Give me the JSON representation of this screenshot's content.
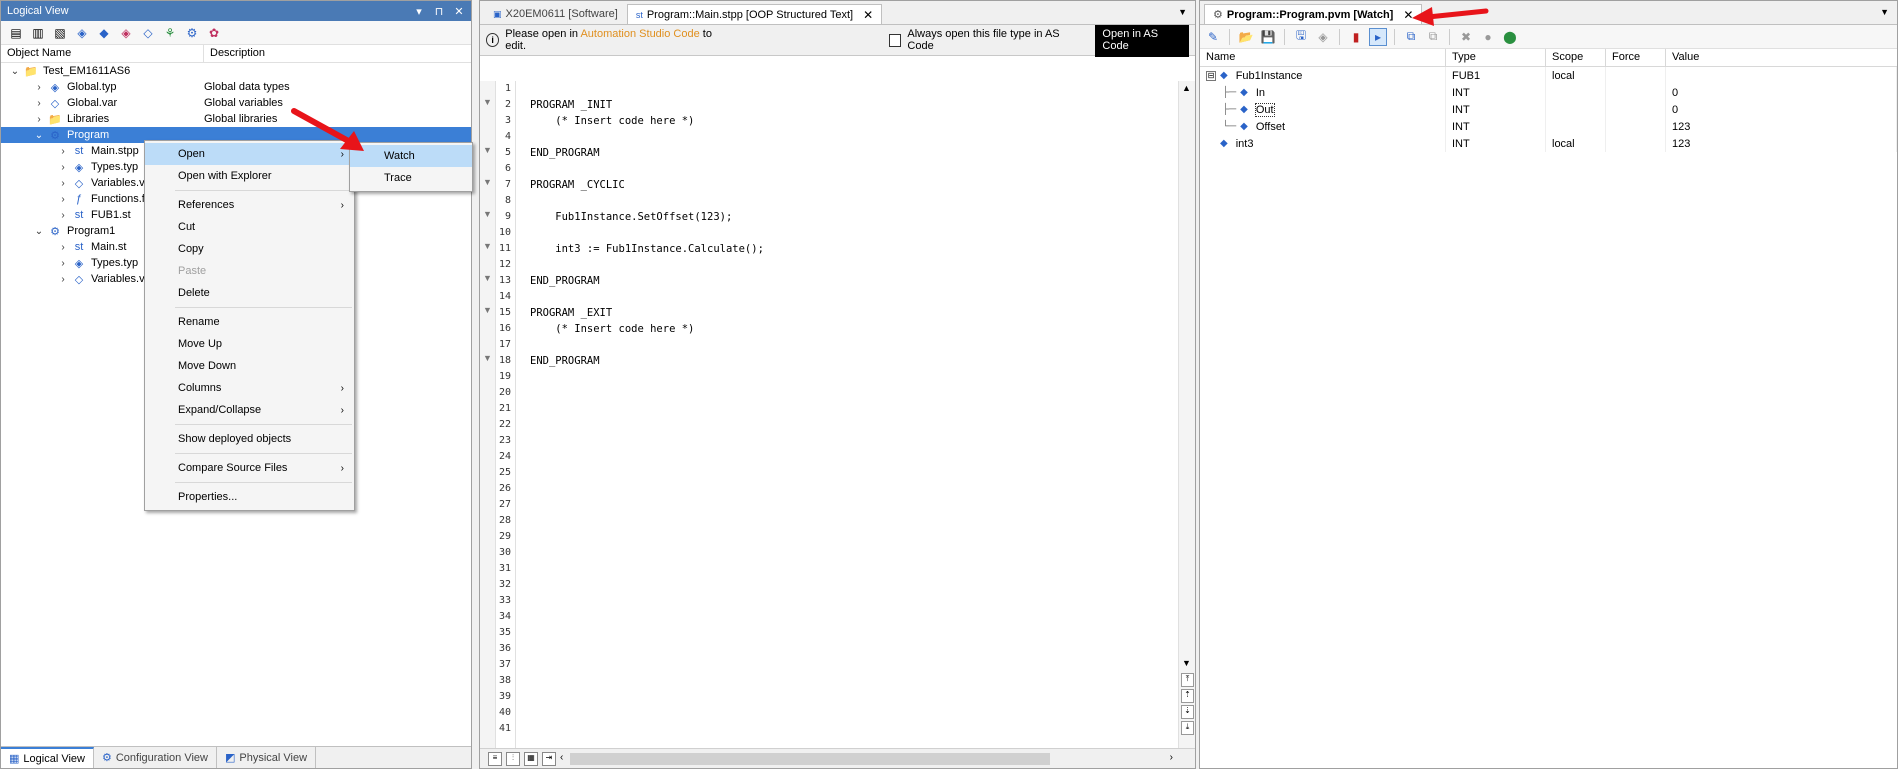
{
  "logical_view": {
    "title": "Logical View",
    "title_buttons": [
      "▾",
      "⊓",
      "✕"
    ],
    "columns": [
      "Object Name",
      "Description"
    ],
    "tree": [
      {
        "indent": 0,
        "twisty": "⌄",
        "icon": "folder-icon",
        "glyph": "📁",
        "name": "Test_EM1611AS6",
        "desc": ""
      },
      {
        "indent": 1,
        "twisty": "›",
        "icon": "global-type-icon",
        "glyph": "◈",
        "name": "Global.typ",
        "desc": "Global data types"
      },
      {
        "indent": 1,
        "twisty": "›",
        "icon": "global-var-icon",
        "glyph": "◇",
        "name": "Global.var",
        "desc": "Global variables"
      },
      {
        "indent": 1,
        "twisty": "›",
        "icon": "libraries-folder-icon",
        "glyph": "📁",
        "name": "Libraries",
        "desc": "Global libraries"
      },
      {
        "indent": 1,
        "twisty": "⌄",
        "icon": "program-icon",
        "glyph": "⚙",
        "name": "Program",
        "desc": "",
        "selected": true
      },
      {
        "indent": 2,
        "twisty": "›",
        "icon": "st-file-icon",
        "glyph": "st",
        "name": "Main.stpp",
        "desc": ""
      },
      {
        "indent": 2,
        "twisty": "›",
        "icon": "types-icon",
        "glyph": "◈",
        "name": "Types.typ",
        "desc": ""
      },
      {
        "indent": 2,
        "twisty": "›",
        "icon": "variables-icon",
        "glyph": "◇",
        "name": "Variables.var",
        "desc": ""
      },
      {
        "indent": 2,
        "twisty": "›",
        "icon": "function-icon",
        "glyph": "ƒ",
        "name": "Functions.fun",
        "desc": ""
      },
      {
        "indent": 2,
        "twisty": "›",
        "icon": "st-file-icon",
        "glyph": "st",
        "name": "FUB1.st",
        "desc": ""
      },
      {
        "indent": 1,
        "twisty": "⌄",
        "icon": "program-icon",
        "glyph": "⚙",
        "name": "Program1",
        "desc": ""
      },
      {
        "indent": 2,
        "twisty": "›",
        "icon": "st-file-icon",
        "glyph": "st",
        "name": "Main.st",
        "desc": ""
      },
      {
        "indent": 2,
        "twisty": "›",
        "icon": "types-icon",
        "glyph": "◈",
        "name": "Types.typ",
        "desc": ""
      },
      {
        "indent": 2,
        "twisty": "›",
        "icon": "variables-icon",
        "glyph": "◇",
        "name": "Variables.var",
        "desc": ""
      }
    ],
    "bottom_tabs": [
      {
        "label": "Logical View",
        "icon": "logical-view-icon",
        "glyph": "▦",
        "active": true
      },
      {
        "label": "Configuration View",
        "icon": "configuration-view-icon",
        "glyph": "⚙",
        "active": false
      },
      {
        "label": "Physical View",
        "icon": "physical-view-icon",
        "glyph": "◩",
        "active": false
      }
    ]
  },
  "context_menu": {
    "items": [
      {
        "label": "Open",
        "submenu": true,
        "highlight": true
      },
      {
        "label": "Open with Explorer"
      },
      {
        "sep": true
      },
      {
        "label": "References",
        "submenu": true
      },
      {
        "label": "Cut"
      },
      {
        "label": "Copy"
      },
      {
        "label": "Paste",
        "disabled": true
      },
      {
        "label": "Delete"
      },
      {
        "sep": true
      },
      {
        "label": "Rename"
      },
      {
        "label": "Move Up"
      },
      {
        "label": "Move Down"
      },
      {
        "label": "Columns",
        "submenu": true
      },
      {
        "label": "Expand/Collapse",
        "submenu": true
      },
      {
        "sep": true
      },
      {
        "label": "Show deployed objects"
      },
      {
        "sep": true
      },
      {
        "label": "Compare Source Files",
        "submenu": true
      },
      {
        "sep": true
      },
      {
        "label": "Properties..."
      }
    ],
    "submenu": [
      {
        "label": "Watch",
        "highlight": true
      },
      {
        "label": "Trace"
      }
    ]
  },
  "editor": {
    "tabs": [
      {
        "label": "X20EM0611 [Software]",
        "icon": "software-icon",
        "glyph": "▣",
        "active": false
      },
      {
        "label": "Program::Main.stpp [OOP Structured Text]",
        "icon": "st-file-icon",
        "glyph": "st",
        "active": true
      }
    ],
    "info_prefix": "Please open in",
    "info_link": "Automation Studio Code",
    "info_suffix": "to edit.",
    "checkbox_label": "Always open this file type in AS Code",
    "open_button": "Open in AS Code",
    "code_lines": [
      "",
      "PROGRAM _INIT",
      "    (* Insert code here *)",
      "",
      "END_PROGRAM",
      "",
      "PROGRAM _CYCLIC",
      "",
      "    Fub1Instance.SetOffset(123);",
      "",
      "    int3 := Fub1Instance.Calculate();",
      "",
      "END_PROGRAM",
      "",
      "PROGRAM _EXIT",
      "    (* Insert code here *)",
      "",
      "END_PROGRAM"
    ],
    "line_count": 41,
    "fold_lines": [
      2,
      5,
      7,
      9,
      11,
      13,
      15,
      18
    ]
  },
  "watch": {
    "tab_label": "Program::Program.pvm [Watch]",
    "columns": [
      "Name",
      "Type",
      "Scope",
      "Force",
      "Value"
    ],
    "rows": [
      {
        "level": 0,
        "expander": "⊟",
        "name": "Fub1Instance",
        "type": "FUB1",
        "scope": "local",
        "force": "",
        "value": ""
      },
      {
        "level": 1,
        "line": "├",
        "name": "In",
        "type": "INT",
        "scope": "",
        "force": "",
        "value": "0"
      },
      {
        "level": 1,
        "line": "├",
        "name": "Out",
        "type": "INT",
        "scope": "",
        "force": "",
        "value": "0",
        "focus": true
      },
      {
        "level": 1,
        "line": "└",
        "name": "Offset",
        "type": "INT",
        "scope": "",
        "force": "",
        "value": "123"
      },
      {
        "level": 0,
        "name": "int3",
        "type": "INT",
        "scope": "local",
        "force": "",
        "value": "123"
      }
    ]
  },
  "colors": {
    "accent": "#3b7fd6",
    "arrow": "#e8141a",
    "link": "#e09020"
  }
}
